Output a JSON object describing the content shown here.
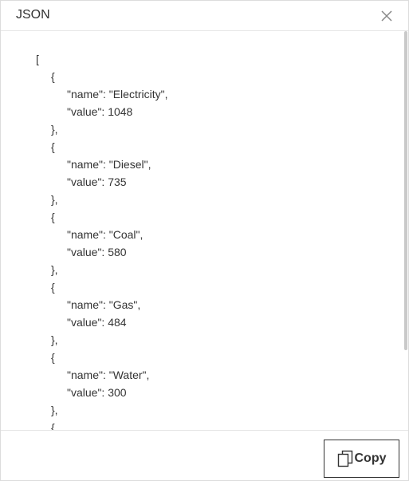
{
  "dialog": {
    "title": "JSON",
    "close_icon": "close-icon",
    "copy_label": "Copy",
    "copy_icon": "copy-icon"
  },
  "json_view": {
    "lines": [
      "[",
      "{",
      "\"name\": \"Electricity\",",
      "\"value\": 1048",
      "},",
      "{",
      "\"name\": \"Diesel\",",
      "\"value\": 735",
      "},",
      "{",
      "\"name\": \"Coal\",",
      "\"value\": 580",
      "},",
      "{",
      "\"name\": \"Gas\",",
      "\"value\": 484",
      "},",
      "{",
      "\"name\": \"Water\",",
      "\"value\": 300",
      "},",
      "{"
    ]
  }
}
